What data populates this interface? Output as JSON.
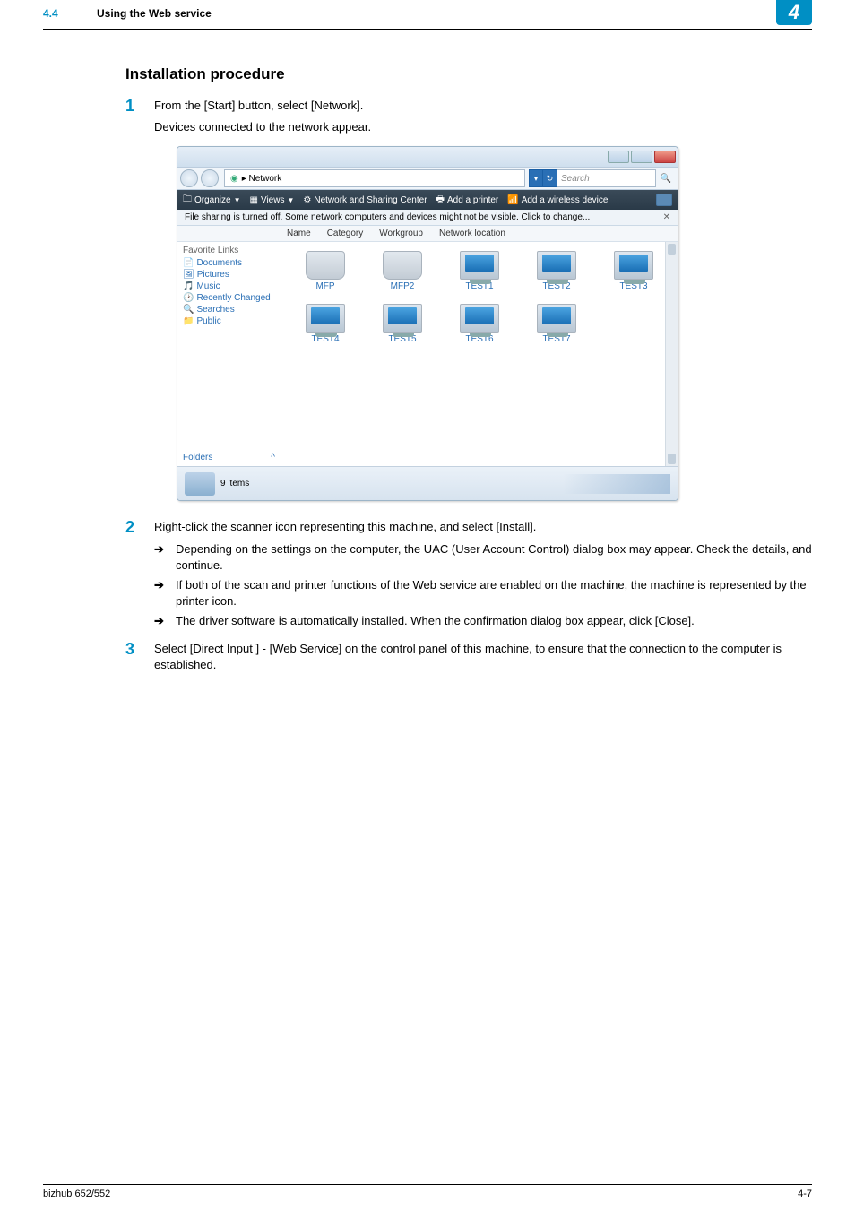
{
  "header": {
    "section_number": "4.4",
    "section_title": "Using the Web service",
    "chapter_badge": "4"
  },
  "procedure": {
    "title": "Installation procedure",
    "steps": [
      {
        "num": "1",
        "text": "From the [Start] button, select [Network].",
        "sub": "Devices connected to the network appear."
      },
      {
        "num": "2",
        "text": "Right-click the scanner icon representing this machine, and select [Install]."
      },
      {
        "num": "3",
        "text": "Select [Direct Input ] - [Web Service] on the control panel of this machine, to ensure that the connection to the computer is established."
      }
    ],
    "bullets_after_2": [
      "Depending on the settings on the computer, the UAC (User Account Control) dialog box may appear. Check the details, and continue.",
      "If both of the scan and printer functions of the Web service are enabled on the machine, the machine is represented by the printer icon.",
      "The driver software is automatically installed. When the confirmation dialog box appear, click [Close]."
    ]
  },
  "window": {
    "breadcrumb": "Network",
    "search_placeholder": "Search",
    "toolbar": {
      "organize": "Organize",
      "views": "Views",
      "network_center": "Network and Sharing Center",
      "add_printer": "Add a printer",
      "add_wireless": "Add a wireless device"
    },
    "info_bar": "File sharing is turned off. Some network computers and devices might not be visible. Click to change...",
    "columns": {
      "name": "Name",
      "category": "Category",
      "workgroup": "Workgroup",
      "location": "Network location"
    },
    "sidebar": {
      "header": "Favorite Links",
      "items": [
        "Documents",
        "Pictures",
        "Music",
        "Recently Changed",
        "Searches",
        "Public"
      ],
      "folders": "Folders"
    },
    "devices_row1": [
      "MFP",
      "MFP2",
      "TEST1",
      "TEST2",
      "TEST3"
    ],
    "devices_row2": [
      "TEST4",
      "TEST5",
      "TEST6",
      "TEST7"
    ],
    "status_items": "9 items"
  },
  "footer": {
    "product": "bizhub 652/552",
    "page": "4-7"
  }
}
